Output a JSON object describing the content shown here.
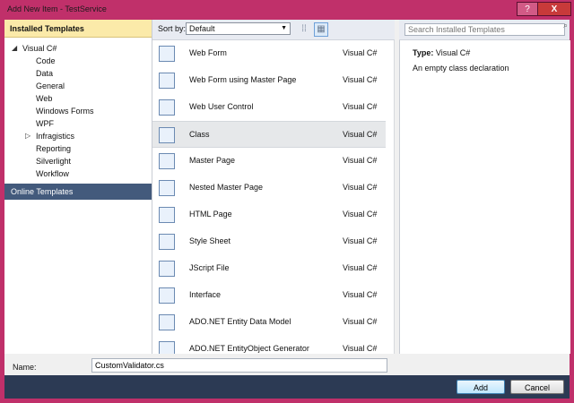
{
  "window": {
    "title": "Add New Item - TestService",
    "help_label": "?",
    "close_label": "X"
  },
  "tree": {
    "header": "Installed Templates",
    "items": [
      {
        "label": "Visual C#",
        "expander": "◢"
      },
      {
        "label": "Code"
      },
      {
        "label": "Data"
      },
      {
        "label": "General"
      },
      {
        "label": "Web"
      },
      {
        "label": "Windows Forms"
      },
      {
        "label": "WPF"
      },
      {
        "label": "Infragistics",
        "expander": "▷"
      },
      {
        "label": "Reporting"
      },
      {
        "label": "Silverlight"
      },
      {
        "label": "Workflow"
      }
    ],
    "online": "Online Templates"
  },
  "toolbar": {
    "sort_label": "Sort by:",
    "sort_value": "Default"
  },
  "search": {
    "placeholder": "Search Installed Templates"
  },
  "templates": [
    {
      "name": "Web Form",
      "lang": "Visual C#",
      "icon": "web-form-icon"
    },
    {
      "name": "Web Form using Master Page",
      "lang": "Visual C#",
      "icon": "web-form-master-icon"
    },
    {
      "name": "Web User Control",
      "lang": "Visual C#",
      "icon": "user-control-icon"
    },
    {
      "name": "Class",
      "lang": "Visual C#",
      "icon": "class-icon",
      "selected": true
    },
    {
      "name": "Master Page",
      "lang": "Visual C#",
      "icon": "master-page-icon"
    },
    {
      "name": "Nested Master Page",
      "lang": "Visual C#",
      "icon": "nested-master-page-icon"
    },
    {
      "name": "HTML Page",
      "lang": "Visual C#",
      "icon": "html-page-icon"
    },
    {
      "name": "Style Sheet",
      "lang": "Visual C#",
      "icon": "style-sheet-icon"
    },
    {
      "name": "JScript File",
      "lang": "Visual C#",
      "icon": "jscript-file-icon"
    },
    {
      "name": "Interface",
      "lang": "Visual C#",
      "icon": "interface-icon"
    },
    {
      "name": "ADO.NET Entity Data Model",
      "lang": "Visual C#",
      "icon": "entity-data-model-icon"
    },
    {
      "name": "ADO.NET EntityObject Generator",
      "lang": "Visual C#",
      "icon": "entity-generator-icon"
    }
  ],
  "detail": {
    "type_label": "Type:",
    "type_value": "Visual C#",
    "description": "An empty class declaration"
  },
  "bottom": {
    "name_label": "Name:",
    "name_value": "CustomValidator.cs",
    "add_label": "Add",
    "cancel_label": "Cancel"
  }
}
